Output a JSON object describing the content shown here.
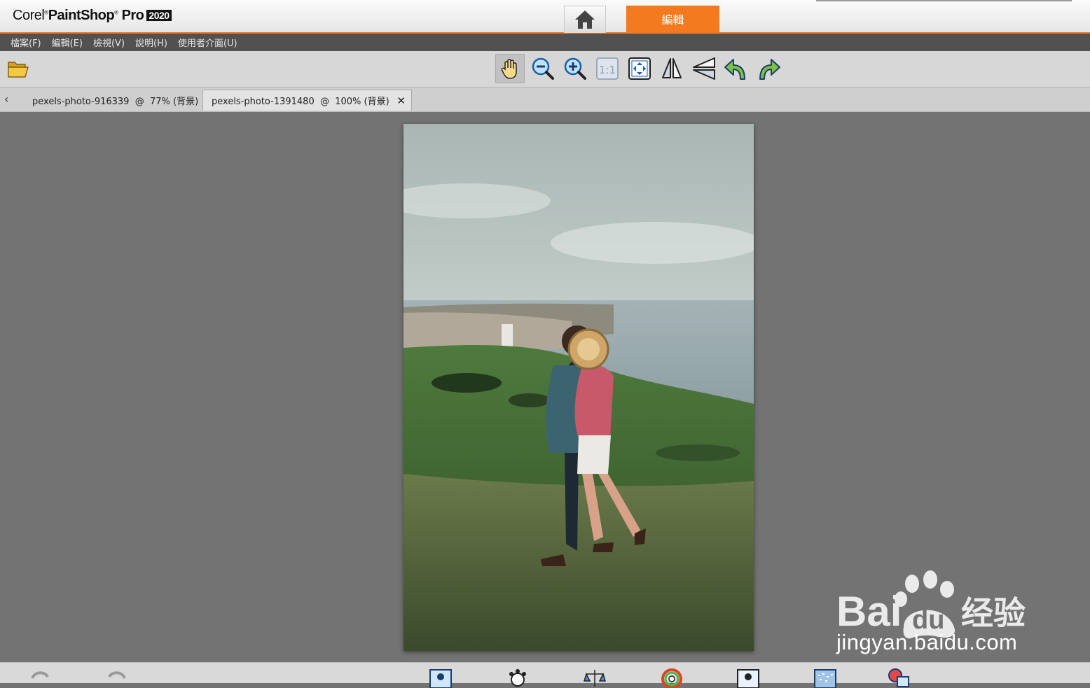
{
  "app": {
    "brand_corel": "Corel",
    "brand_product": "PaintShop",
    "brand_pro": "Pro",
    "brand_year": "2020",
    "tabs": {
      "home_icon": "home-icon",
      "edit_label": "編輯"
    }
  },
  "menu": {
    "items": [
      "檔案(F)",
      "編輯(E)",
      "檢視(V)",
      "說明(H)",
      "使用者介面(U)"
    ]
  },
  "toolbar": {
    "tools": [
      "open-folder-icon",
      "pan-hand-icon",
      "zoom-out-icon",
      "zoom-in-icon",
      "actual-size-icon",
      "fit-window-icon",
      "flip-horizontal-icon",
      "flip-vertical-icon",
      "rotate-left-icon",
      "rotate-right-icon"
    ],
    "actual_size_label": "1:1",
    "active_tool": "pan-hand-icon"
  },
  "documents": {
    "tabs": [
      {
        "label": "pexels-photo-916339  @  77% (背景)"
      },
      {
        "label": "pexels-photo-1391480  @  100% (背景)",
        "active": true
      }
    ]
  },
  "watermark": {
    "brand": "Bai",
    "brand2": "du",
    "brand_cn": "经验",
    "url": "jingyan.baidu.com"
  },
  "colors": {
    "accent": "#f47a1f",
    "menubar": "#515151",
    "toolbar": "#d7d7d7",
    "workspace": "#737373"
  }
}
